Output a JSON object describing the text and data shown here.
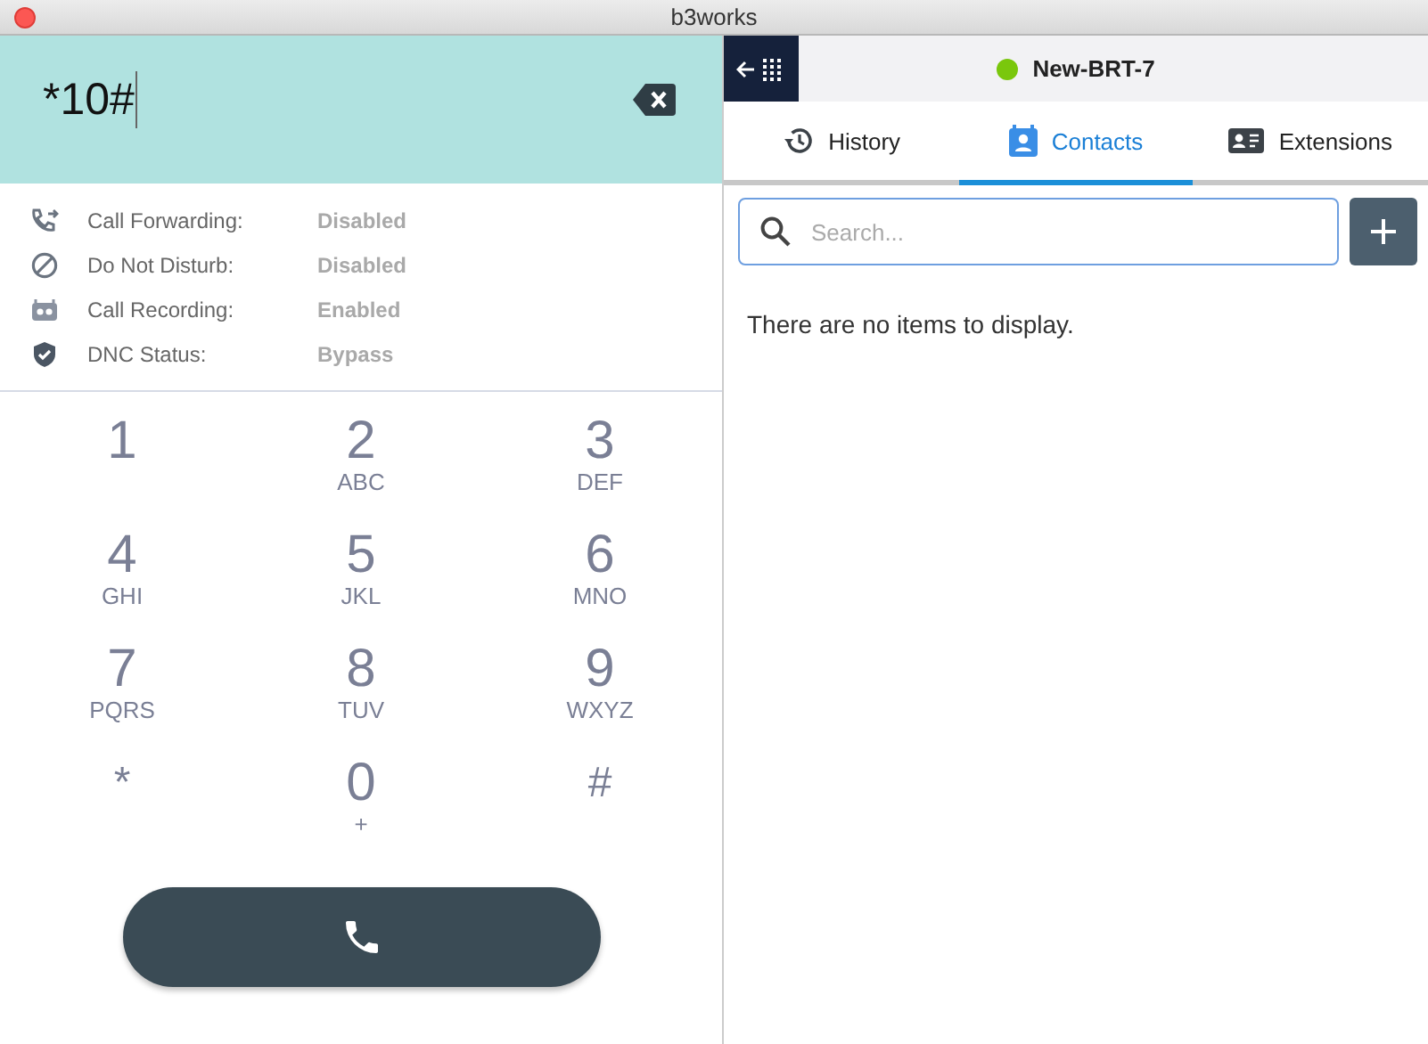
{
  "window": {
    "title": "b3works"
  },
  "dialer": {
    "value": "*10#",
    "settings": [
      {
        "label": "Call Forwarding:",
        "value": "Disabled"
      },
      {
        "label": "Do Not Disturb:",
        "value": "Disabled"
      },
      {
        "label": "Call Recording:",
        "value": "Enabled"
      },
      {
        "label": "DNC Status:",
        "value": "Bypass"
      }
    ],
    "keys": [
      {
        "digit": "1"
      },
      {
        "digit": "2",
        "letters": "ABC"
      },
      {
        "digit": "3",
        "letters": "DEF"
      },
      {
        "digit": "4",
        "letters": "GHI"
      },
      {
        "digit": "5",
        "letters": "JKL"
      },
      {
        "digit": "6",
        "letters": "MNO"
      },
      {
        "digit": "7",
        "letters": "PQRS"
      },
      {
        "digit": "8",
        "letters": "TUV"
      },
      {
        "digit": "9",
        "letters": "WXYZ"
      },
      {
        "digit": "*"
      },
      {
        "digit": "0",
        "letters": "+"
      },
      {
        "digit": "#"
      }
    ]
  },
  "header": {
    "name": "New-BRT-7",
    "status": {
      "color": "#7ac70c"
    }
  },
  "tabs": [
    {
      "label": "History",
      "selected": false
    },
    {
      "label": "Contacts",
      "selected": true
    },
    {
      "label": "Extensions",
      "selected": false
    }
  ],
  "search": {
    "placeholder": "Search..."
  },
  "empty_message": "There are no items to display."
}
